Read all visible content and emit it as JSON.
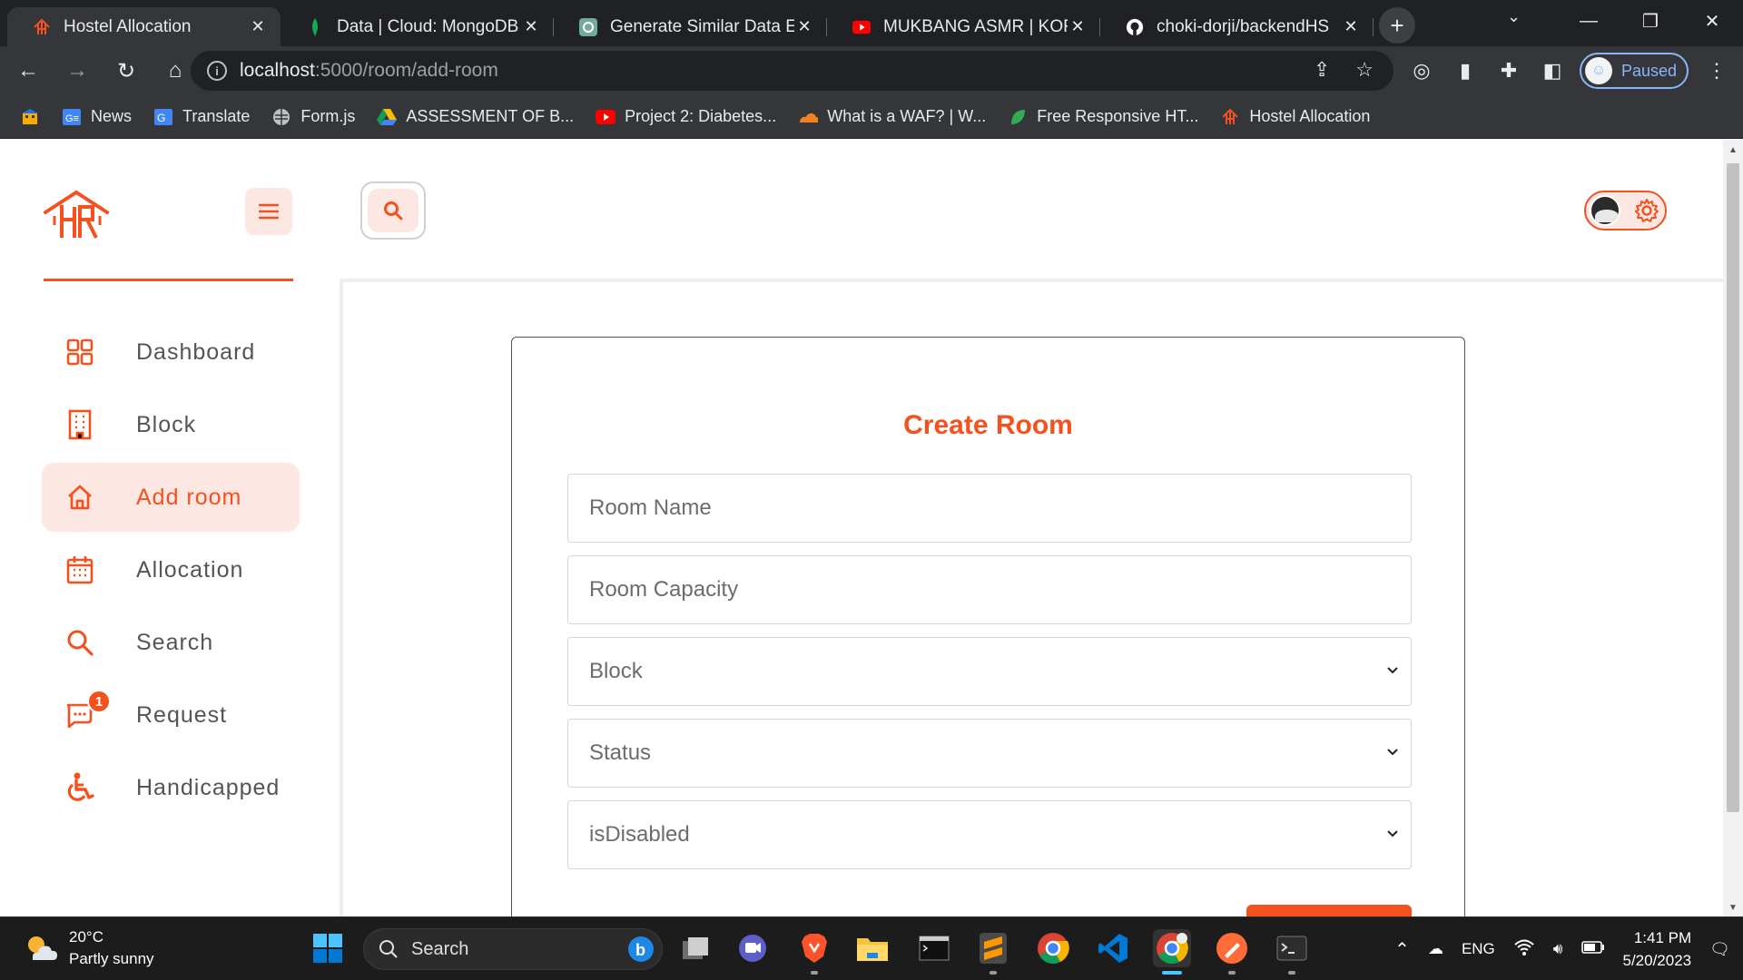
{
  "browser": {
    "tabs": [
      {
        "title": "Hostel Allocation",
        "active": true
      },
      {
        "title": "Data | Cloud: MongoDB C",
        "active": false
      },
      {
        "title": "Generate Similar Data Ent",
        "active": false
      },
      {
        "title": "MUKBANG ASMR | KOREA",
        "active": false
      },
      {
        "title": "choki-dorji/backendHS",
        "active": false
      }
    ],
    "url_host": "localhost",
    "url_path": ":5000/room/add-room",
    "profile_label": "Paused",
    "bookmarks": [
      {
        "label": "News",
        "icon": "google-news-icon"
      },
      {
        "label": "Translate",
        "icon": "google-translate-icon"
      },
      {
        "label": "Form.js",
        "icon": "globe-icon"
      },
      {
        "label": "ASSESSMENT OF B...",
        "icon": "google-drive-icon"
      },
      {
        "label": "Project 2: Diabetes...",
        "icon": "youtube-icon"
      },
      {
        "label": "What is a WAF? | W...",
        "icon": "cloudflare-icon"
      },
      {
        "label": "Free Responsive HT...",
        "icon": "leaf-icon"
      },
      {
        "label": "Hostel Allocation",
        "icon": "hostel-logo-icon"
      }
    ]
  },
  "app": {
    "accent_color": "#f4511e",
    "accent_light": "#fde7e2",
    "sidebar": {
      "items": [
        {
          "label": "Dashboard",
          "icon": "dashboard-icon"
        },
        {
          "label": "Block",
          "icon": "building-icon"
        },
        {
          "label": "Add room",
          "icon": "home-icon",
          "active": true
        },
        {
          "label": "Allocation",
          "icon": "calendar-icon"
        },
        {
          "label": "Search",
          "icon": "search-icon"
        },
        {
          "label": "Request",
          "icon": "chat-icon",
          "badge": "1"
        },
        {
          "label": "Handicapped",
          "icon": "wheelchair-icon"
        }
      ]
    },
    "form": {
      "title": "Create Room",
      "room_name_placeholder": "Room Name",
      "room_capacity_placeholder": "Room Capacity",
      "block_select": "Block",
      "status_select": "Status",
      "disabled_select": "isDisabled"
    }
  },
  "taskbar": {
    "weather_temp": "20°C",
    "weather_desc": "Partly sunny",
    "search_label": "Search",
    "language": "ENG",
    "time": "1:41 PM",
    "date": "5/20/2023"
  }
}
